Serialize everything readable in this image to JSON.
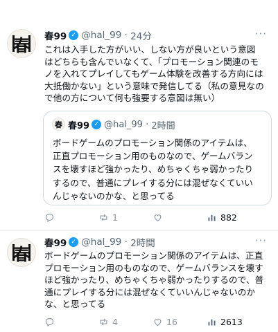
{
  "tweet1": {
    "avatar_char": "春",
    "name": "春99",
    "handle": "@hal_99",
    "time": "24分",
    "lines": [
      "これは入手した方がいい、しない方が良いという意図",
      "はどちらも含んでいなくて、「プロモーション関連のモ",
      "ノを入れてプレイしてもゲーム体験を改善する方向には",
      "大抵働かない」という意味で発信してる（私の意見なの",
      "で他の方について何も強要する意図は無い）"
    ],
    "quote": {
      "name": "春99",
      "handle": "@hal_99",
      "time": "2時間",
      "lines": [
        "ボードゲームのプロモーション関係のアイテムは、",
        "正直プロモーション用のものなので、ゲームバラン",
        "スを壊すほど強かったり、めちゃくちゃ弱かったり",
        "するので、普通にプレイする分には混ぜなくていい",
        "んじゃないのかな、と思ってる"
      ]
    },
    "retweets": "1",
    "likes": "",
    "views": "882"
  },
  "tweet2": {
    "avatar_char": "春",
    "name": "春99",
    "handle": "@hal_99",
    "time": "2時間",
    "lines": [
      "ボードゲームのプロモーション関係のアイテムは、正直",
      "プロモーション用のものなので、ゲームバランスを壊す",
      "ほど強かったり、めちゃくちゃ弱かったりするので、普",
      "通にプレイする分には混ぜなくていいんじゃないのか",
      "な、と思ってる"
    ],
    "retweets": "4",
    "likes": "16",
    "views": "2613"
  },
  "icons": {
    "more": "more-options-icon",
    "reply": "reply-icon",
    "retweet": "retweet-icon",
    "like": "like-icon",
    "views": "views-icon",
    "verified": "verified-badge-icon"
  },
  "colors": {
    "verified": "#1d9bf0",
    "text": "#0f1419",
    "muted": "#536471",
    "divider": "#eff3f4"
  }
}
